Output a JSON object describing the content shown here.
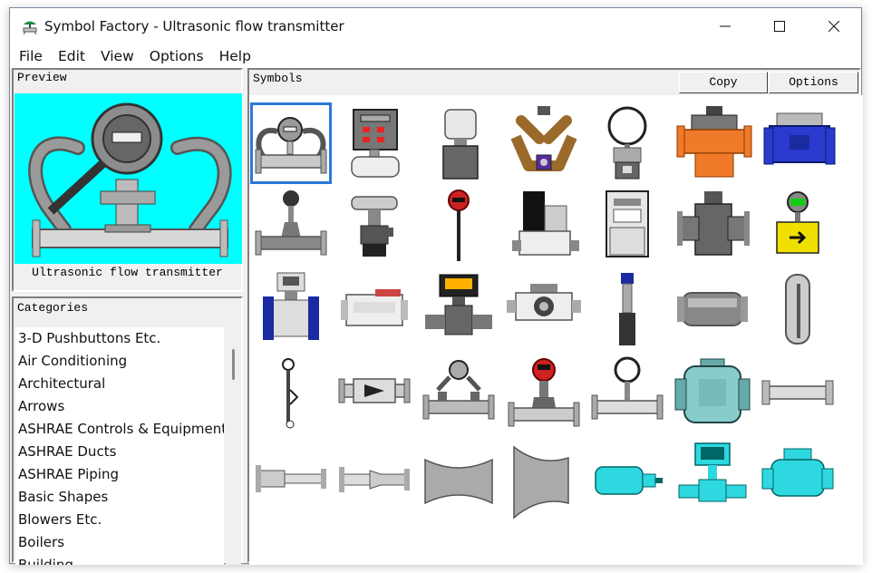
{
  "window": {
    "title": "Symbol Factory - Ultrasonic flow transmitter"
  },
  "menu": [
    "File",
    "Edit",
    "View",
    "Options",
    "Help"
  ],
  "preview": {
    "label": "Preview",
    "caption": "Ultrasonic flow transmitter",
    "background": "#00ffff"
  },
  "categories": {
    "label": "Categories",
    "items": [
      "3-D Pushbuttons Etc.",
      "Air Conditioning",
      "Architectural",
      "Arrows",
      "ASHRAE Controls & Equipment",
      "ASHRAE Ducts",
      "ASHRAE Piping",
      "Basic Shapes",
      "Blowers Etc.",
      "Boilers",
      "Building..."
    ]
  },
  "symbols": {
    "label": "Symbols",
    "copy_label": "Copy",
    "options_label": "Options",
    "selected_index": 0,
    "items": [
      "ultrasonic-flow-transmitter",
      "panel-meter-flow",
      "cylinder-flowmeter",
      "clamp-on-flowmeter",
      "gauge-flowmeter",
      "orange-turbine-meter",
      "blue-water-meter",
      "vortex-flowmeter",
      "tee-flowmeter",
      "red-probe-transmitter",
      "mass-flow-controller",
      "electronic-flow-computer",
      "gray-mag-meter",
      "yellow-arrow-transmitter",
      "blue-mag-flowmeter",
      "inline-sensor-box",
      "display-valve-meter",
      "wafer-flowmeter",
      "insertion-sensor",
      "pipe-spool",
      "vertical-sensor",
      "paddle-switch",
      "sight-flow-indicator",
      "ultrasonic-twin-sensor",
      "red-head-transmitter",
      "gauge-on-pipe",
      "teal-check-valve",
      "pipe-section",
      "flanged-reducer",
      "flanged-venturi",
      "bellmouth-duct",
      "flared-duct",
      "cyan-motor-sensor",
      "cyan-control-valve",
      "cyan-pump-valve"
    ]
  },
  "colors": {
    "cyan": "#00ffff",
    "selection": "#2a7ad5",
    "window_bg": "#f0f0f0"
  }
}
